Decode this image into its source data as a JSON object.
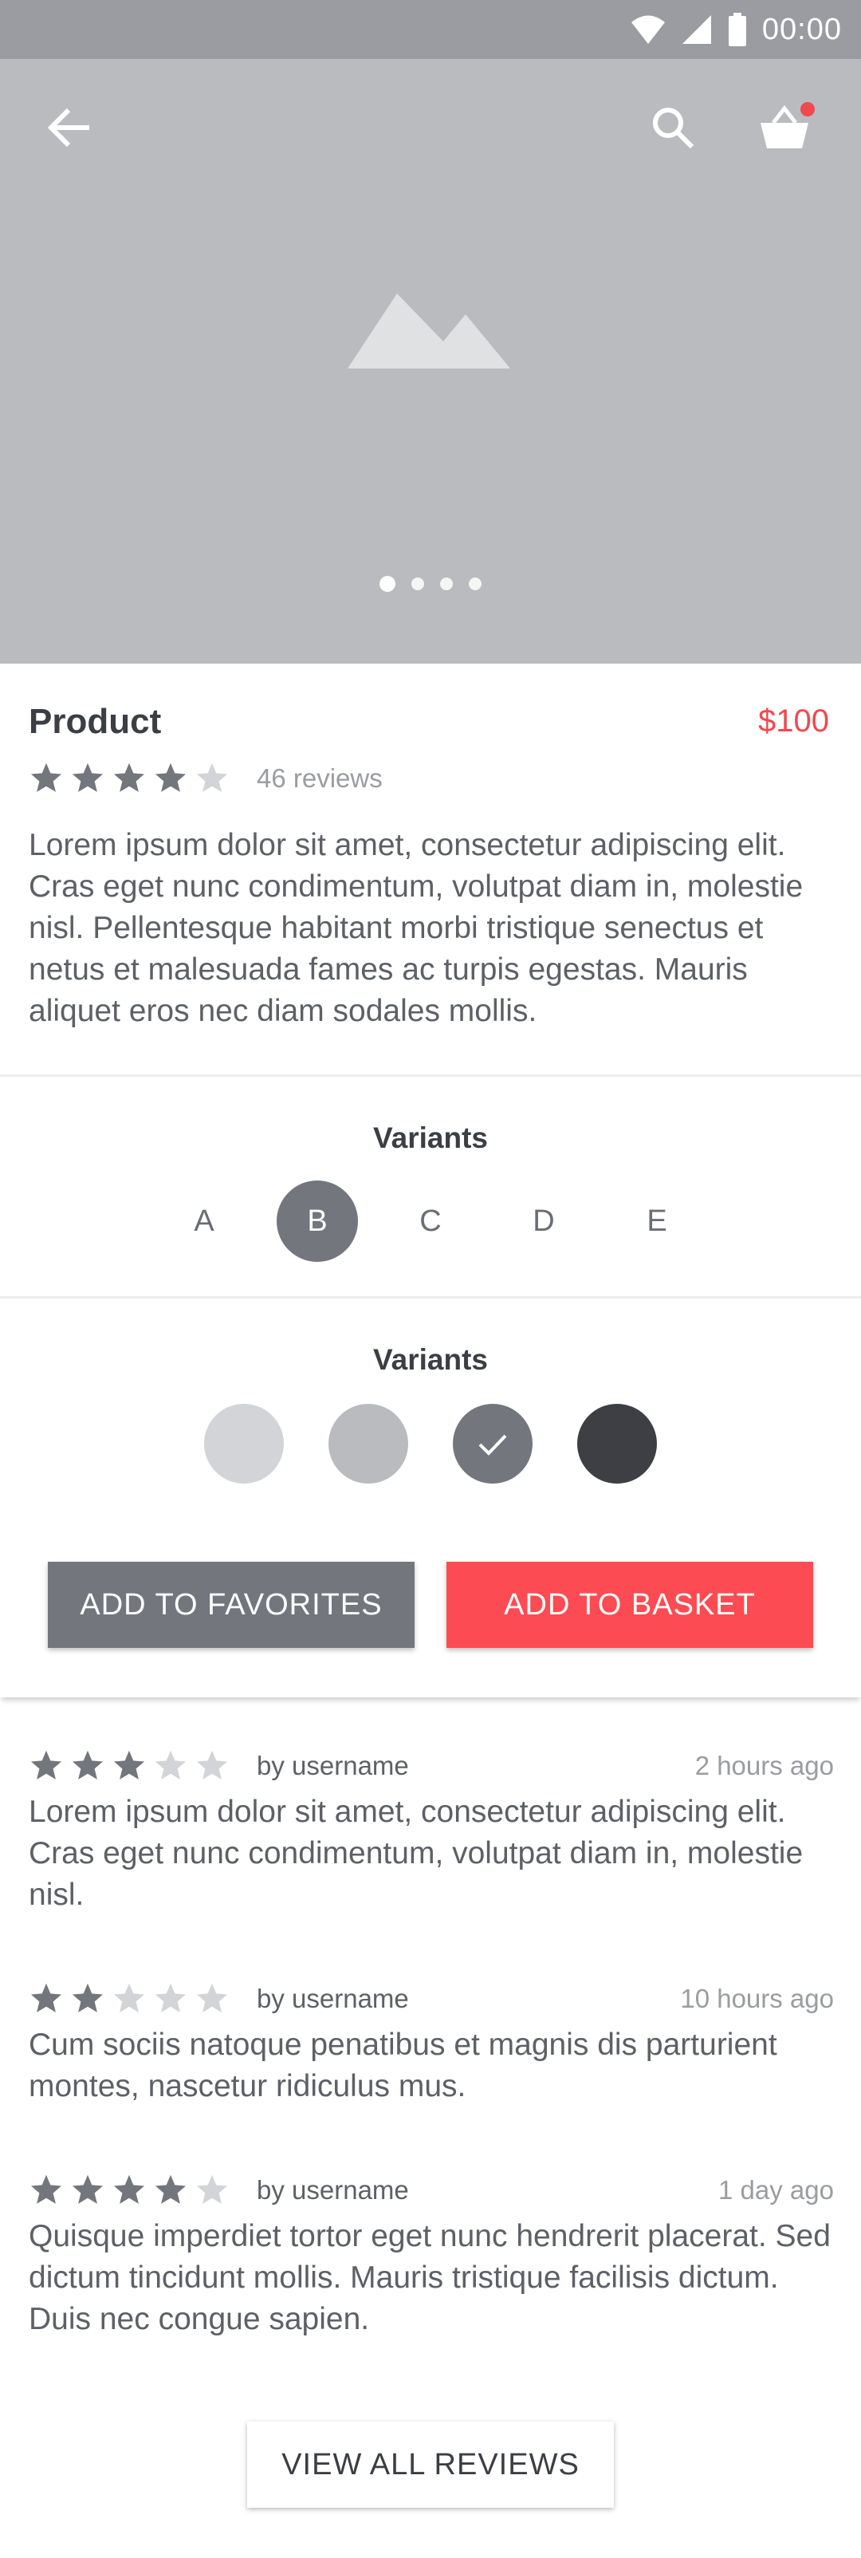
{
  "status_bar": {
    "time": "00:00",
    "icons": [
      "wifi-icon",
      "signal-icon",
      "battery-icon"
    ]
  },
  "hero": {
    "icons": {
      "back": "arrow-left-icon",
      "search": "search-icon",
      "cart": "basket-icon",
      "placeholder": "image-placeholder-icon"
    },
    "cart_badge": true,
    "pager": {
      "count": 4,
      "active_index": 0
    }
  },
  "product": {
    "title": "Product",
    "price": "$100",
    "rating": 4,
    "rating_max": 5,
    "reviews_label": "46 reviews",
    "description": "Lorem ipsum dolor sit amet, consectetur adipiscing elit. Cras eget nunc condimentum, volutpat diam in, molestie nisl. Pellentesque habitant morbi tristique senectus et netus et malesuada fames ac turpis egestas. Mauris aliquet eros nec diam sodales mollis."
  },
  "variants_letters": {
    "title": "Variants",
    "options": [
      "A",
      "B",
      "C",
      "D",
      "E"
    ],
    "selected_index": 1
  },
  "variants_colors": {
    "title": "Variants",
    "options": [
      "#d2d4d8",
      "#b9bbbf",
      "#73767d",
      "#3d3f44"
    ],
    "selected_index": 2
  },
  "actions": {
    "favorites_label": "ADD TO FAVORITES",
    "basket_label": "ADD TO BASKET"
  },
  "reviews": [
    {
      "rating": 3,
      "user": "by username",
      "time": "2 hours ago",
      "text": "Lorem ipsum dolor sit amet, consectetur adipiscing elit. Cras eget nunc condimentum, volutpat diam in, molestie nisl."
    },
    {
      "rating": 2,
      "user": "by username",
      "time": "10 hours ago",
      "text": "Cum sociis natoque penatibus et magnis dis parturient montes, nascetur ridiculus mus."
    },
    {
      "rating": 4,
      "user": "by username",
      "time": "1 day ago",
      "text": "Quisque imperdiet tortor eget nunc hendrerit placerat. Sed dictum tincidunt mollis. Mauris tristique facilisis dictum. Duis nec congue sapien."
    }
  ],
  "view_all_label": "VIEW ALL REVIEWS",
  "colors": {
    "accent": "#f0494e",
    "star_on": "#73767d",
    "star_off": "#d2d4d8"
  }
}
